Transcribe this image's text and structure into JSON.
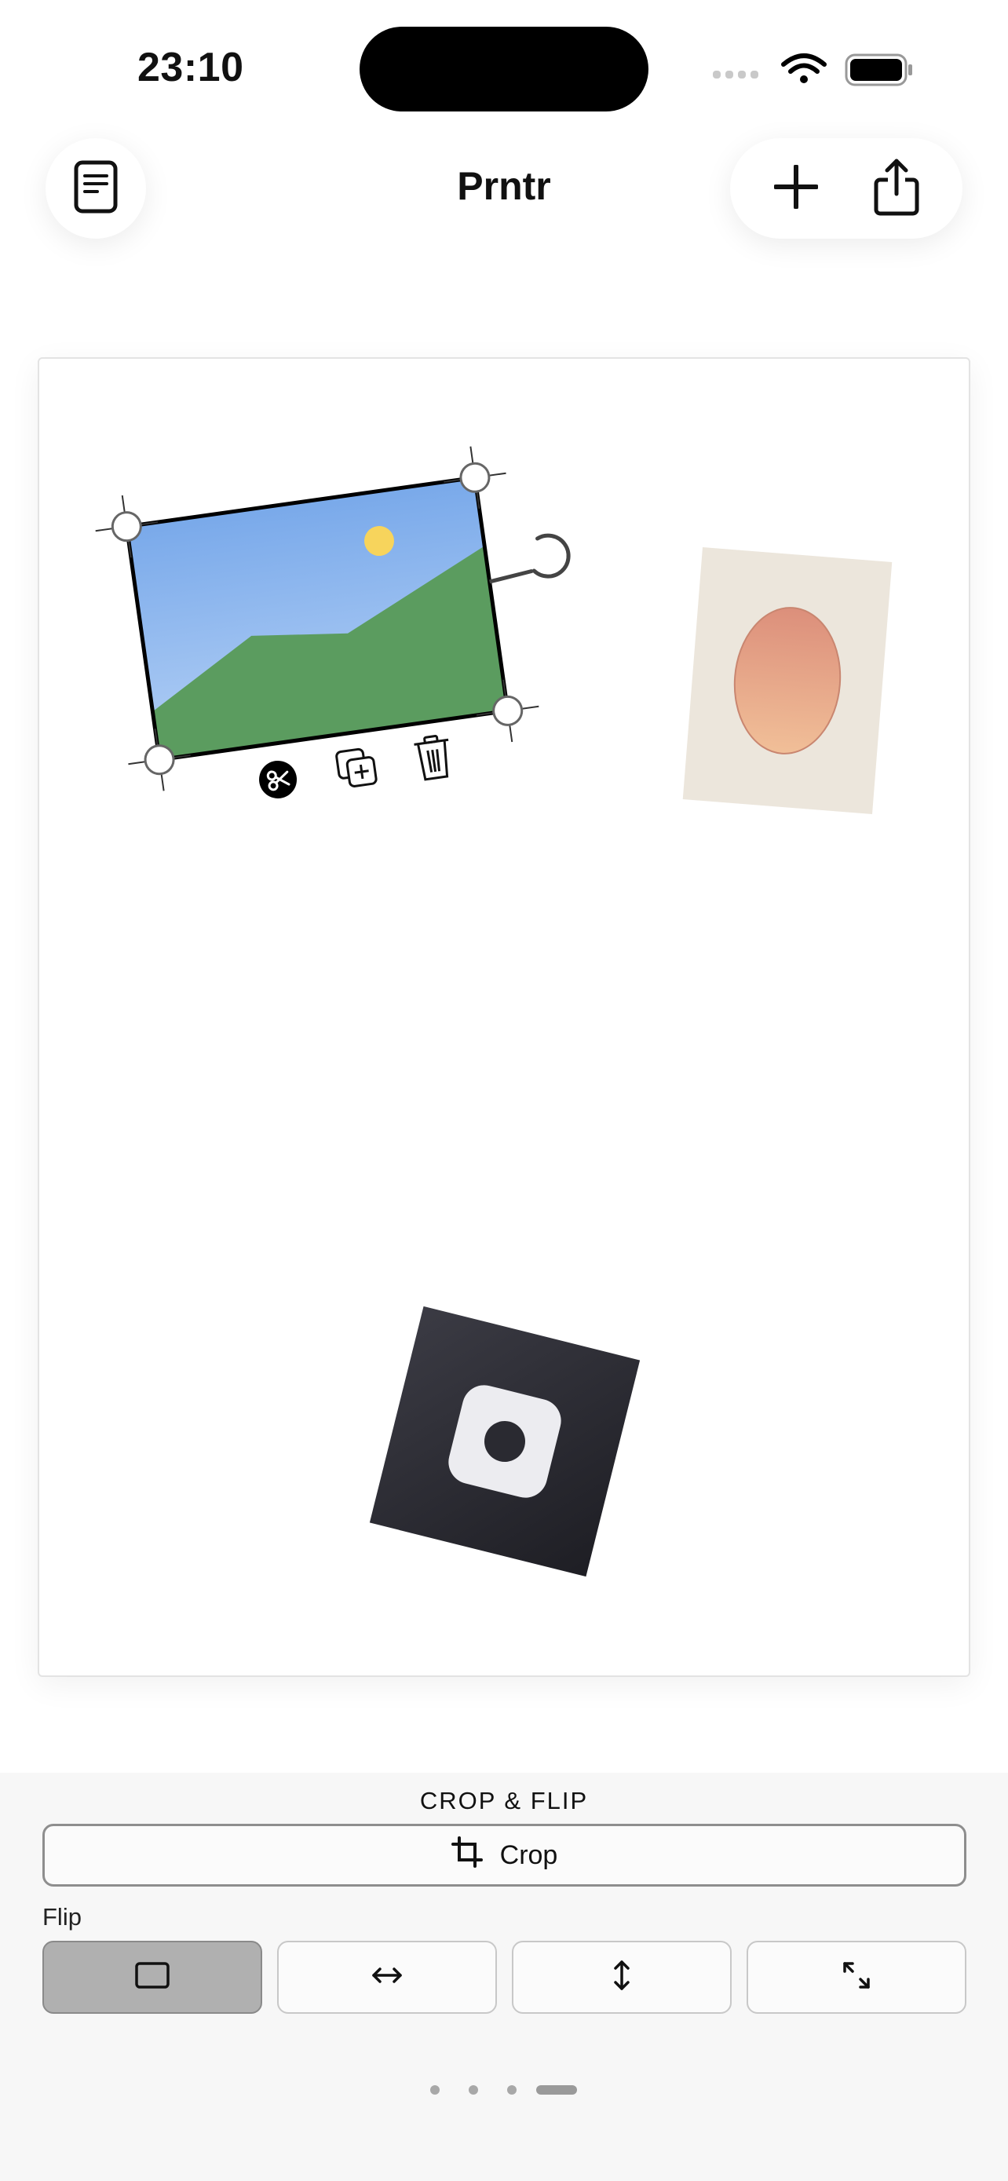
{
  "status_bar": {
    "time": "23:10",
    "icons": [
      "cellular-icon",
      "wifi-icon",
      "battery-icon"
    ]
  },
  "nav": {
    "title": "Prntr",
    "left_button_icon": "document-icon",
    "right_button_icons": [
      "plus-icon",
      "share-icon"
    ]
  },
  "canvas": {
    "items": [
      {
        "kind": "image",
        "description_icon": "landscape-photo",
        "selected": true
      },
      {
        "kind": "image",
        "description_icon": "oval-gradient-card",
        "selected": false
      },
      {
        "kind": "image",
        "description_icon": "camera-app-icon",
        "selected": false
      }
    ],
    "selection_tools": [
      "scissors-icon",
      "duplicate-icon",
      "trash-icon"
    ],
    "colors": {
      "sky_top": "#79a9ea",
      "sky_bottom": "#a9c9f4",
      "hill": "#5b9c5f",
      "sun": "#f7d45c",
      "card_bg": "#ece6dc",
      "oval_top": "#dc917b",
      "oval_bottom": "#f0bd98",
      "camera_dark": "#2a2a31"
    }
  },
  "panel": {
    "section_title": "CROP & FLIP",
    "crop_label": "Crop",
    "flip_label": "Flip",
    "flip_options": [
      "none-icon",
      "flip-horizontal-icon",
      "flip-vertical-icon",
      "flip-diagonal-icon"
    ],
    "selected_flip_index": 0
  },
  "page_indicator": {
    "count": 4,
    "active_index": 3
  }
}
